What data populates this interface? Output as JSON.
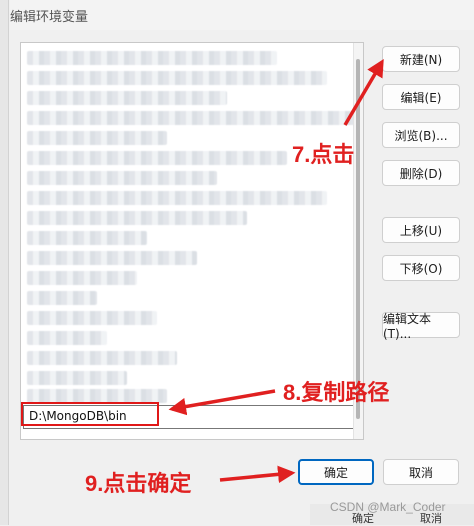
{
  "window": {
    "title": "编辑环境变量"
  },
  "list": {
    "selected_value": "D:\\MongoDB\\bin"
  },
  "buttons": {
    "new": "新建(N)",
    "edit": "编辑(E)",
    "browse": "浏览(B)...",
    "delete": "删除(D)",
    "move_up": "上移(U)",
    "move_down": "下移(O)",
    "edit_text": "编辑文本(T)...",
    "ok": "确定",
    "cancel": "取消"
  },
  "annotations": {
    "step7": "7.点击",
    "step8": "8.复制路径",
    "step9": "9.点击确定",
    "color": "#e02020"
  },
  "watermark": "CSDN @Mark_Coder",
  "bottom_bar": {
    "ok_label": "确定",
    "cancel_label": "取消"
  },
  "colors": {
    "primary_border": "#0067c0",
    "highlight": "#e01818"
  }
}
